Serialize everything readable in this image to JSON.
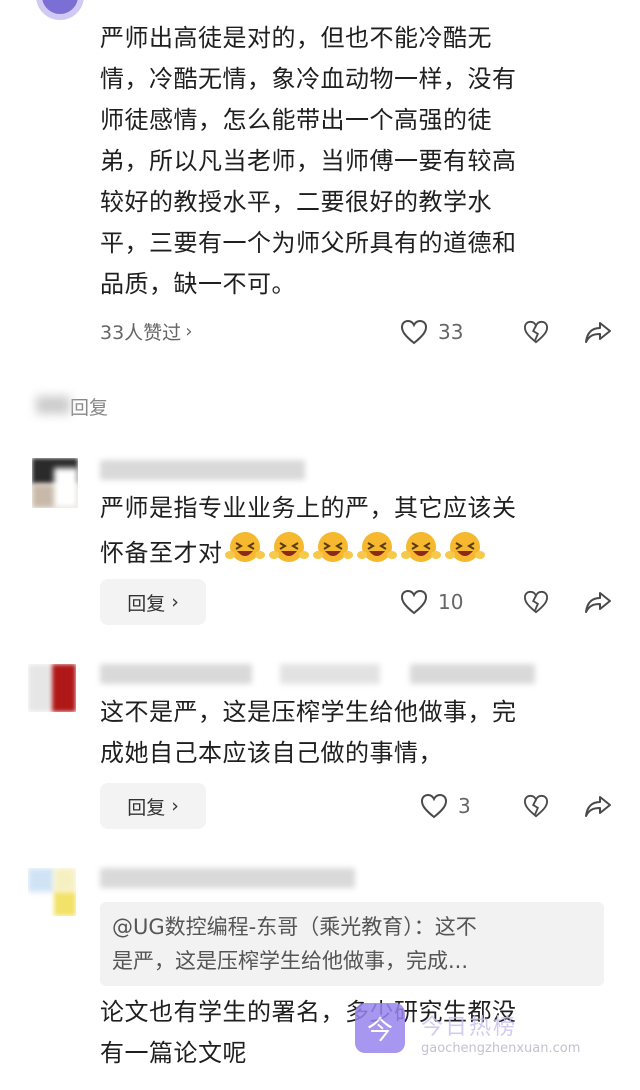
{
  "comment1": {
    "text_lines": [
      "严师出高徒是对的，但也不能冷酷无",
      "情，冷酷无情，象冷血动物一样，没有",
      "师徒感情，怎么能带出一个高强的徒",
      "弟，所以凡当老师，当师傅一要有较高",
      "较好的教授水平，二要很好的教学水",
      "平，三要有一个为师父所具有的道德和",
      "品质，缺一不可。"
    ],
    "likes_link": "33人赞过",
    "like_count": "33"
  },
  "replies_label": "回复",
  "reply1": {
    "text_lines": [
      "严师是指专业业务上的严，其它应该关",
      "怀备至才对"
    ],
    "emoji_count": 6,
    "reply_button": "回复",
    "like_count": "10"
  },
  "reply2": {
    "text_lines": [
      "这不是严，这是压榨学生给他做事，完",
      "成她自己本应该自己做的事情，"
    ],
    "reply_button": "回复",
    "like_count": "3"
  },
  "reply3": {
    "quote_lines": [
      "@UG数控编程-东哥（乘光教育）：这不",
      "是严，这是压榨学生给他做事，完成..."
    ],
    "text_lines": [
      "论文也有学生的署名，多少研究生都没",
      "有一篇论文呢"
    ]
  },
  "watermark": {
    "logo_char": "今",
    "title": "今日热榜",
    "url": "gaochengzhenxuan.com"
  },
  "colors": {
    "icon": "#4a4a4a",
    "muted": "#666666",
    "emoji": "#f5b82e"
  },
  "icons": [
    "heart-outline-icon",
    "broken-heart-icon",
    "share-arrow-icon",
    "chevron-right-icon",
    "laughing-emoji-icon"
  ]
}
